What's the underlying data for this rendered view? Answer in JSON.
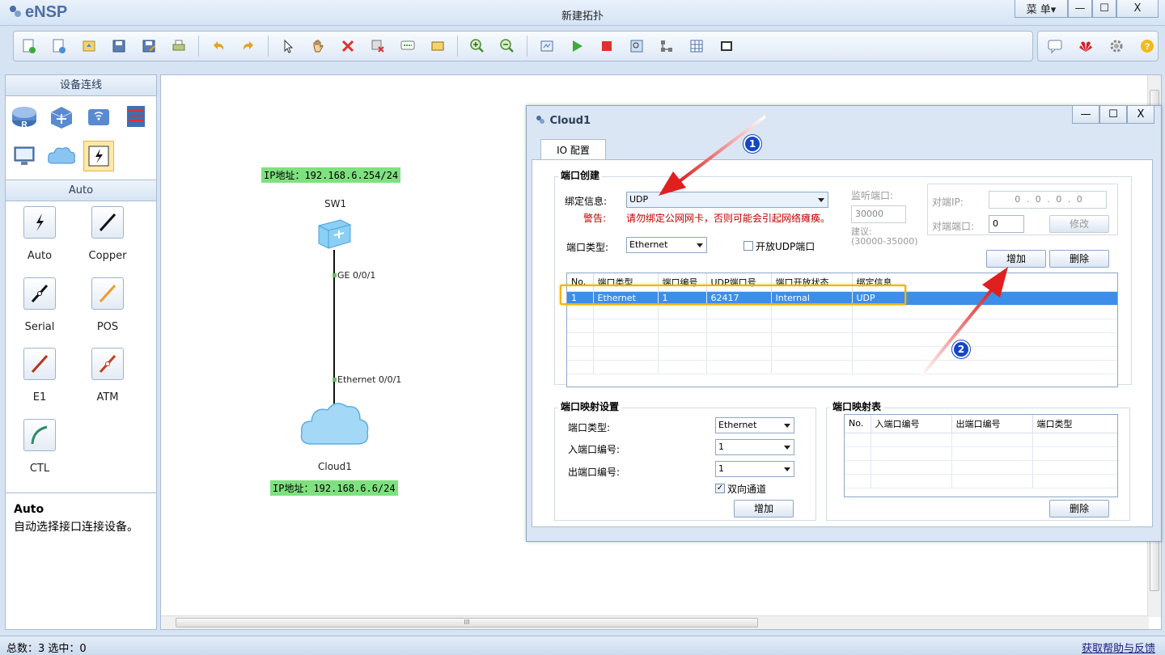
{
  "app": {
    "logo": "eNSP",
    "window_title": "新建拓扑",
    "menu_label": "菜 单▾",
    "min_symbol": "—",
    "max_symbol": "☐",
    "close_symbol": "X"
  },
  "toolbar": {
    "icons": [
      "new-topology-icon",
      "new-example-icon",
      "open-icon",
      "save-icon",
      "save-as-icon",
      "print-icon",
      "undo-icon",
      "redo-icon",
      "select-pointer-icon",
      "hand-pan-icon",
      "delete-icon",
      "delete-connections-icon",
      "text-annotation-icon",
      "palette-icon",
      "zoom-in-icon",
      "zoom-out-icon",
      "fit-view-icon",
      "start-all-icon",
      "stop-all-icon",
      "capture-icon",
      "topology-icon",
      "grid-icon",
      "screenshot-icon"
    ],
    "right_icons": [
      "chat-icon",
      "huawei-logo-icon",
      "settings-gear-icon",
      "help-icon"
    ]
  },
  "left_panel": {
    "device_header": "设备连线",
    "cable_header": "Auto",
    "devices": [
      "router",
      "switch",
      "wlan",
      "firewall",
      "pc",
      "cloud",
      "auto-connection"
    ],
    "cables": [
      {
        "label": "Auto",
        "icon": "auto-cable-icon"
      },
      {
        "label": "Copper",
        "icon": "copper-cable-icon"
      },
      {
        "label": "Serial",
        "icon": "serial-cable-icon"
      },
      {
        "label": "POS",
        "icon": "pos-cable-icon"
      },
      {
        "label": "E1",
        "icon": "e1-cable-icon"
      },
      {
        "label": "ATM",
        "icon": "atm-cable-icon"
      },
      {
        "label": "CTL",
        "icon": "ctl-cable-icon"
      }
    ],
    "desc_title": "Auto",
    "desc_text": "自动选择接口连接设备。"
  },
  "canvas": {
    "sw1_ip": "IP地址：192.168.6.254/24",
    "sw1_name": "SW1",
    "sw1_port": "GE 0/0/1",
    "cloud_port": "Ethernet 0/0/1",
    "cloud_name": "Cloud1",
    "cloud_ip": "IP地址：192.168.6.6/24",
    "scroll_grip": "III"
  },
  "dialog": {
    "title": "Cloud1",
    "tab": "IO 配置",
    "port_create": {
      "group_title": "端口创建",
      "bind_label": "绑定信息:",
      "bind_value": "UDP",
      "warn_label": "警告:",
      "warn_text": "请勿绑定公网网卡，否则可能会引起网络瘫痪。",
      "port_type_label": "端口类型:",
      "port_type_value": "Ethernet",
      "open_udp_label": "开放UDP端口",
      "listen_label": "监听端口:",
      "listen_value": "30000",
      "suggest_label": "建议:",
      "suggest_range": "(30000-35000)",
      "peer_ip_label": "对端IP:",
      "peer_ip_value": "0 . 0 . 0 . 0",
      "peer_port_label": "对端端口:",
      "peer_port_value": "0",
      "modify_button": "修改",
      "add_button": "增加",
      "delete_button": "删除",
      "table": {
        "headers": [
          "No.",
          "端口类型",
          "端口编号",
          "UDP端口号",
          "端口开放状态",
          "绑定信息"
        ],
        "rows": [
          [
            "1",
            "Ethernet",
            "1",
            "62417",
            "Internal",
            "UDP"
          ]
        ]
      }
    },
    "port_mapping": {
      "group_title": "端口映射设置",
      "type_label": "端口类型:",
      "type_value": "Ethernet",
      "in_label": "入端口编号:",
      "in_value": "1",
      "out_label": "出端口编号:",
      "out_value": "1",
      "bidirectional_label": "双向通道",
      "bidirectional_checked": "✓",
      "add_button": "增加"
    },
    "mapping_table": {
      "group_title": "端口映射表",
      "headers": [
        "No.",
        "入端口编号",
        "出端口编号",
        "端口类型"
      ],
      "delete_button": "删除"
    }
  },
  "annotations": {
    "marker1": "1",
    "marker2": "2"
  },
  "statusbar": {
    "left": "总数：3  选中：0",
    "right": "获取帮助与反馈"
  },
  "colors": {
    "accent": "#3d8ee8",
    "ip_label_bg": "#7fe07f",
    "warning": "#c00000",
    "highlight_border": "#f0b400",
    "arrow_red": "#e02020",
    "marker_blue": "#1446c8"
  }
}
